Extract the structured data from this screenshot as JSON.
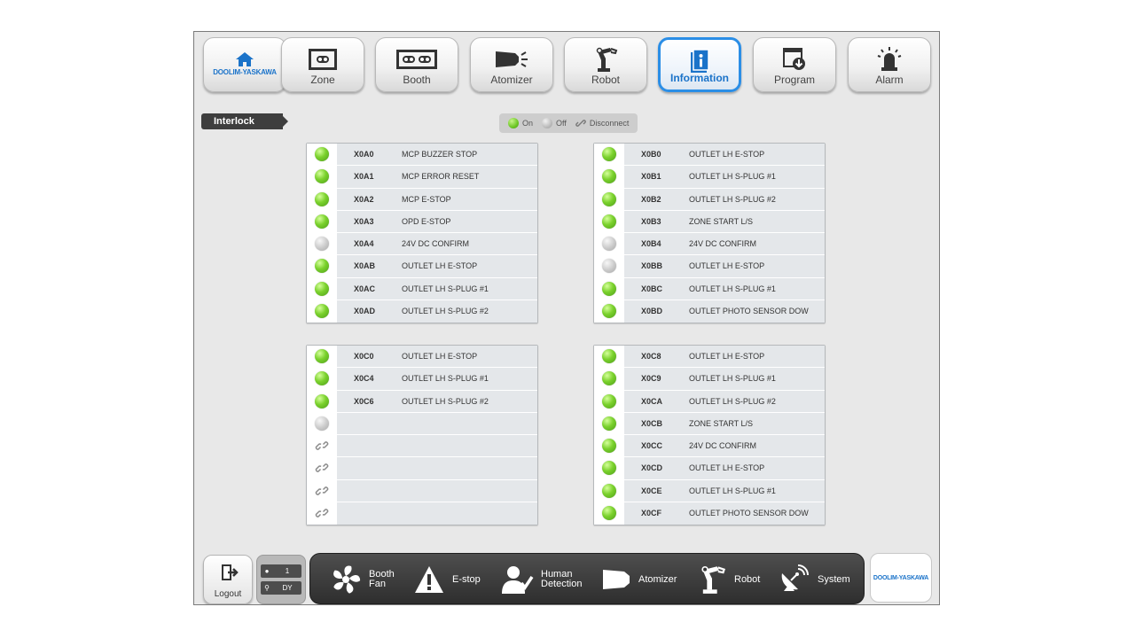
{
  "nav": {
    "home": {
      "label": "DOOLIM-YASKAWA",
      "icon": "home-icon"
    },
    "items": [
      {
        "label": "Zone",
        "icon": "zone-icon"
      },
      {
        "label": "Booth",
        "icon": "booth-icon"
      },
      {
        "label": "Atomizer",
        "icon": "atomizer-icon"
      },
      {
        "label": "Robot",
        "icon": "robot-arm-icon"
      },
      {
        "label": "Information",
        "icon": "info-icon",
        "active": true
      },
      {
        "label": "Program",
        "icon": "program-download-icon"
      },
      {
        "label": "Alarm",
        "icon": "alarm-beacon-icon"
      }
    ],
    "active_color": "#2b8ee6"
  },
  "section": {
    "title": "Interlock"
  },
  "legend": {
    "on": "On",
    "off": "Off",
    "disconnect": "Disconnect"
  },
  "status_colors": {
    "on": "#6cc624",
    "off": "#bcbcbc"
  },
  "panels": [
    {
      "rows": [
        {
          "state": "on",
          "addr": "X0A0",
          "desc": "MCP BUZZER STOP"
        },
        {
          "state": "on",
          "addr": "X0A1",
          "desc": "MCP ERROR RESET"
        },
        {
          "state": "on",
          "addr": "X0A2",
          "desc": "MCP E-STOP"
        },
        {
          "state": "on",
          "addr": "X0A3",
          "desc": "OPD E-STOP"
        },
        {
          "state": "off",
          "addr": "X0A4",
          "desc": "24V DC CONFIRM"
        },
        {
          "state": "on",
          "addr": "X0AB",
          "desc": "OUTLET LH E-STOP"
        },
        {
          "state": "on",
          "addr": "X0AC",
          "desc": "OUTLET LH S-PLUG #1"
        },
        {
          "state": "on",
          "addr": "X0AD",
          "desc": "OUTLET LH S-PLUG #2"
        }
      ]
    },
    {
      "rows": [
        {
          "state": "on",
          "addr": "X0B0",
          "desc": "OUTLET LH E-STOP"
        },
        {
          "state": "on",
          "addr": "X0B1",
          "desc": "OUTLET LH S-PLUG #1"
        },
        {
          "state": "on",
          "addr": "X0B2",
          "desc": "OUTLET LH S-PLUG #2"
        },
        {
          "state": "on",
          "addr": "X0B3",
          "desc": "ZONE START L/S"
        },
        {
          "state": "off",
          "addr": "X0B4",
          "desc": "24V DC CONFIRM"
        },
        {
          "state": "off",
          "addr": "X0BB",
          "desc": "OUTLET LH E-STOP"
        },
        {
          "state": "on",
          "addr": "X0BC",
          "desc": "OUTLET LH S-PLUG #1"
        },
        {
          "state": "on",
          "addr": "X0BD",
          "desc": "OUTLET PHOTO SENSOR DOW"
        }
      ]
    },
    {
      "rows": [
        {
          "state": "on",
          "addr": "X0C0",
          "desc": "OUTLET LH E-STOP"
        },
        {
          "state": "on",
          "addr": "X0C4",
          "desc": "OUTLET LH S-PLUG #1"
        },
        {
          "state": "on",
          "addr": "X0C6",
          "desc": "OUTLET LH S-PLUG #2"
        },
        {
          "state": "off",
          "addr": "",
          "desc": ""
        },
        {
          "state": "disconnect",
          "addr": "",
          "desc": ""
        },
        {
          "state": "disconnect",
          "addr": "",
          "desc": ""
        },
        {
          "state": "disconnect",
          "addr": "",
          "desc": ""
        },
        {
          "state": "disconnect",
          "addr": "",
          "desc": ""
        }
      ]
    },
    {
      "rows": [
        {
          "state": "on",
          "addr": "X0C8",
          "desc": "OUTLET LH E-STOP"
        },
        {
          "state": "on",
          "addr": "X0C9",
          "desc": "OUTLET LH S-PLUG #1"
        },
        {
          "state": "on",
          "addr": "X0CA",
          "desc": "OUTLET LH S-PLUG #2"
        },
        {
          "state": "on",
          "addr": "X0CB",
          "desc": "ZONE START L/S"
        },
        {
          "state": "on",
          "addr": "X0CC",
          "desc": "24V DC CONFIRM"
        },
        {
          "state": "on",
          "addr": "X0CD",
          "desc": "OUTLET LH E-STOP"
        },
        {
          "state": "on",
          "addr": "X0CE",
          "desc": "OUTLET LH S-PLUG #1"
        },
        {
          "state": "on",
          "addr": "X0CF",
          "desc": "OUTLET PHOTO SENSOR DOW"
        }
      ]
    }
  ],
  "footer": {
    "logout": "Logout",
    "user": {
      "id": "1",
      "name": "DY"
    },
    "status_items": [
      {
        "label": "Booth Fan",
        "icon": "fan-icon"
      },
      {
        "label": "E-stop",
        "icon": "warning-icon"
      },
      {
        "label": "Human Detection",
        "icon": "human-detection-icon"
      },
      {
        "label": "Atomizer",
        "icon": "atomizer-icon"
      },
      {
        "label": "Robot",
        "icon": "robot-arm-icon"
      },
      {
        "label": "System",
        "icon": "satellite-dish-icon"
      }
    ],
    "brand": "DOOLIM-YASKAWA"
  }
}
